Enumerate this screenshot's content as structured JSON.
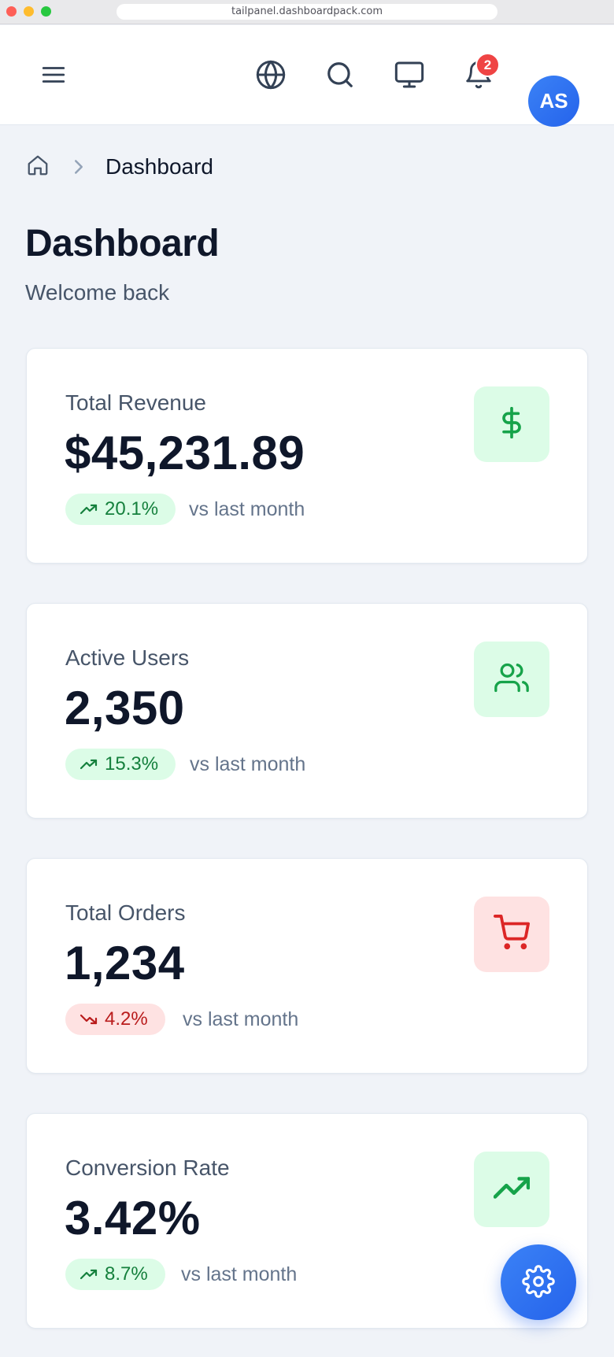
{
  "browser": {
    "url": "tailpanel.dashboardpack.com"
  },
  "header": {
    "icons": [
      "menu-icon",
      "globe-icon",
      "search-icon",
      "monitor-icon",
      "bell-icon"
    ],
    "notification_count": "2",
    "avatar_initials": "AS"
  },
  "breadcrumb": {
    "current": "Dashboard"
  },
  "page": {
    "title": "Dashboard",
    "subtitle": "Welcome back"
  },
  "stats": [
    {
      "label": "Total Revenue",
      "value": "$45,231.89",
      "trend": "20.1%",
      "direction": "up",
      "note": "vs last month",
      "icon": "dollar-icon",
      "color": "#16a34a"
    },
    {
      "label": "Active Users",
      "value": "2,350",
      "trend": "15.3%",
      "direction": "up",
      "note": "vs last month",
      "icon": "users-icon",
      "color": "#16a34a"
    },
    {
      "label": "Total Orders",
      "value": "1,234",
      "trend": "4.2%",
      "direction": "down",
      "note": "vs last month",
      "icon": "cart-icon",
      "color": "#dc2626"
    },
    {
      "label": "Conversion Rate",
      "value": "3.42%",
      "trend": "8.7%",
      "direction": "up",
      "note": "vs last month",
      "icon": "trending-up-icon",
      "color": "#16a34a"
    }
  ],
  "fab": {
    "icon": "settings-icon"
  },
  "colors": {
    "accent": "#2563eb",
    "positive": "#16a34a",
    "negative": "#dc2626",
    "background": "#f0f3f8"
  }
}
